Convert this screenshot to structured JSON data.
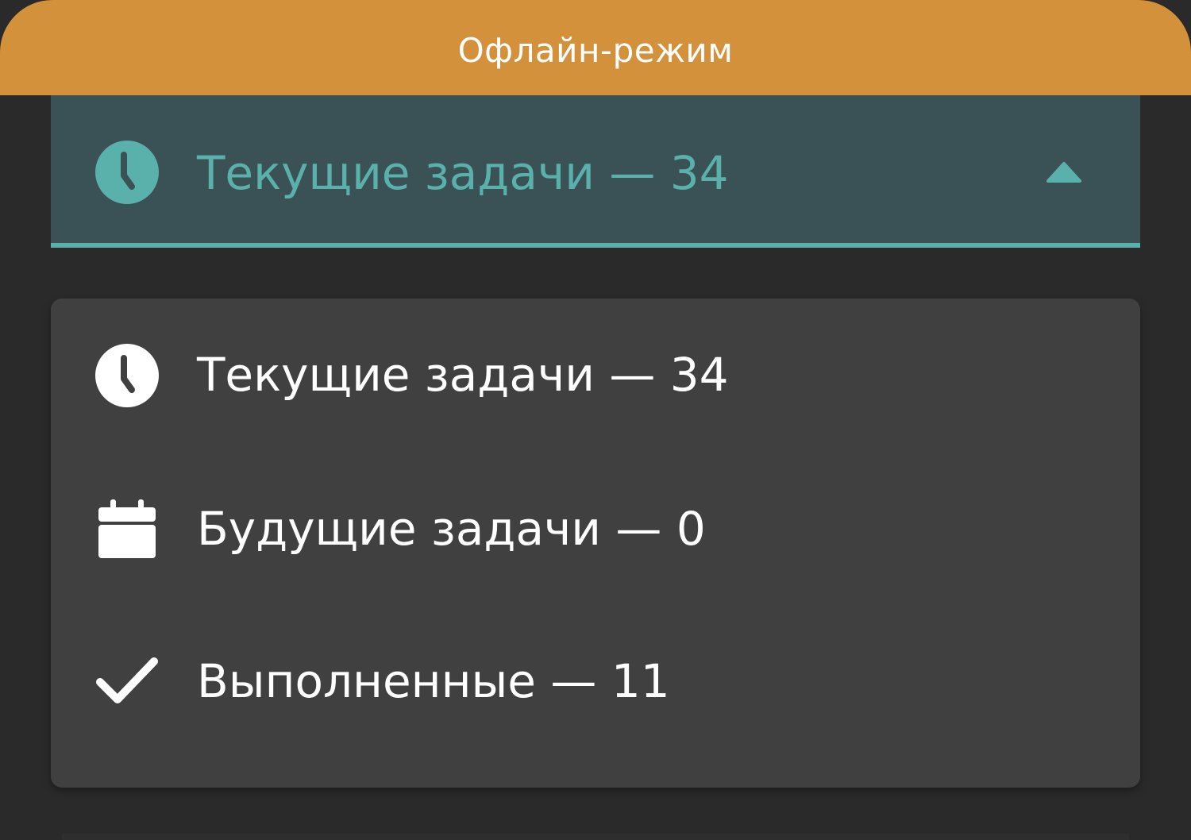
{
  "banner": {
    "text": "Офлайн-режим",
    "color": "#d4913b"
  },
  "selector": {
    "label": "Текущие задачи — 34",
    "icon": "clock-icon",
    "caret_icon": "caret-up-icon",
    "accent_color": "#5ab0aa",
    "background": "#3a5256",
    "expanded": true
  },
  "menu": {
    "items": [
      {
        "label": "Текущие задачи — 34",
        "icon": "clock-icon"
      },
      {
        "label": "Будущие задачи — 0",
        "icon": "calendar-icon"
      },
      {
        "label": "Выполненные — 11",
        "icon": "checkmark-icon"
      }
    ],
    "background": "#404040"
  }
}
